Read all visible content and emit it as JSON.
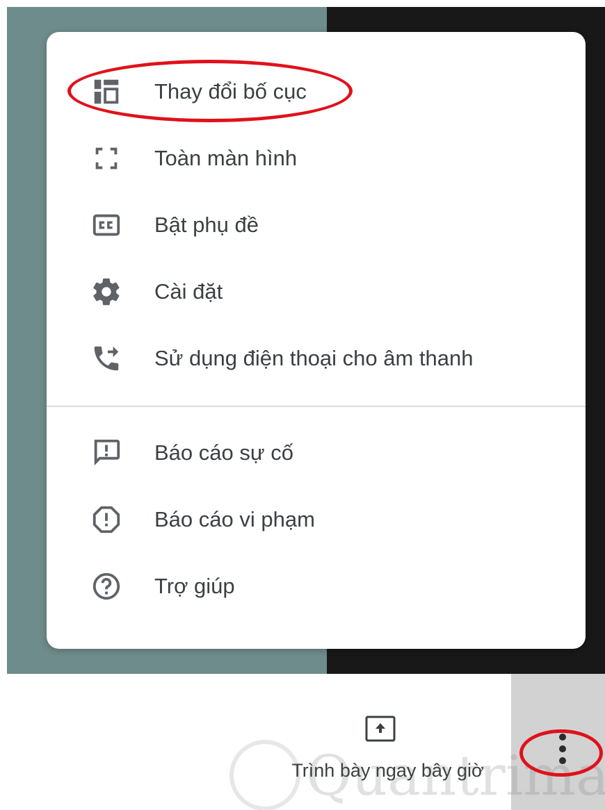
{
  "menu": {
    "items": [
      {
        "label": "Thay đổi bố cục",
        "icon": "change-layout-icon"
      },
      {
        "label": "Toàn màn hình",
        "icon": "fullscreen-icon"
      },
      {
        "label": "Bật phụ đề",
        "icon": "closed-captions-icon"
      },
      {
        "label": "Cài đặt",
        "icon": "gear-icon"
      },
      {
        "label": "Sử dụng điện thoại cho âm thanh",
        "icon": "phone-forward-icon"
      },
      {
        "label": "Báo cáo sự cố",
        "icon": "feedback-icon"
      },
      {
        "label": "Báo cáo vi phạm",
        "icon": "report-abuse-icon"
      },
      {
        "label": "Trợ giúp",
        "icon": "help-icon"
      }
    ]
  },
  "toolbar": {
    "present_label": "Trình bày ngay bây giờ",
    "present_icon": "present-upload-icon",
    "more_icon": "more-vert-icon"
  },
  "watermark": {
    "text": "Quantrimang"
  },
  "colors": {
    "highlight": "#e0111b",
    "text": "#3c4043",
    "icon": "#5f6368"
  }
}
